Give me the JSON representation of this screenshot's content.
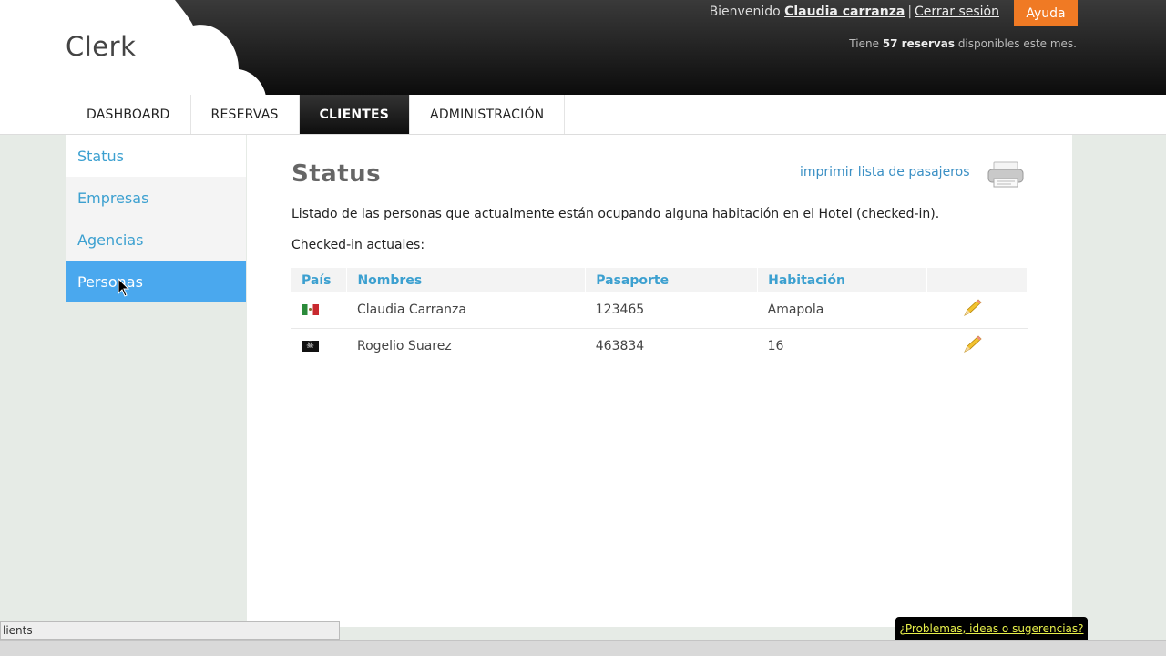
{
  "brand": {
    "name": "Clerk"
  },
  "header": {
    "welcome_prefix": "Bienvenido",
    "user_name": "Claudia carranza",
    "separator": "|",
    "logout_label": "Cerrar sesión",
    "help_label": "Ayuda",
    "quota_prefix": "Tiene",
    "quota_count": "57 reservas",
    "quota_suffix": "disponibles este mes."
  },
  "nav": {
    "items": [
      {
        "label": "DASHBOARD",
        "active": false
      },
      {
        "label": "RESERVAS",
        "active": false
      },
      {
        "label": "CLIENTES",
        "active": true
      },
      {
        "label": "ADMINISTRACIÓN",
        "active": false
      }
    ]
  },
  "sidebar": {
    "items": [
      {
        "label": "Status"
      },
      {
        "label": "Empresas"
      },
      {
        "label": "Agencias"
      },
      {
        "label": "Personas",
        "active": true
      }
    ]
  },
  "main": {
    "title": "Status",
    "print_label": "imprimir lista de pasajeros",
    "description": "Listado de las personas que actualmente están ocupando alguna habitación en el Hotel (checked-in).",
    "subheading": "Checked-in actuales:",
    "table": {
      "headers": [
        "País",
        "Nombres",
        "Pasaporte",
        "Habitación",
        ""
      ],
      "rows": [
        {
          "country_icon": "mexico-flag-icon",
          "name": "Claudia Carranza",
          "passport": "123465",
          "room": "Amapola"
        },
        {
          "country_icon": "pirate-flag-icon",
          "name": "Rogelio Suarez",
          "passport": "463834",
          "room": "16"
        }
      ]
    }
  },
  "status_bar": {
    "text": "lients"
  },
  "feedback": {
    "label": "¿Problemas, ideas o sugerencias?"
  },
  "colors": {
    "accent": "#4aa8ee",
    "link": "#3ca0d0",
    "help": "#f07a24",
    "feedback_text": "#e7ef4a"
  }
}
